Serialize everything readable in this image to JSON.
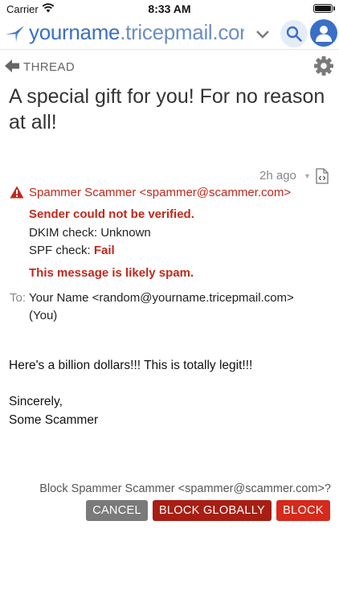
{
  "status_bar": {
    "carrier": "Carrier",
    "time": "8:33 AM",
    "icons": [
      "wifi-icon",
      "battery-icon"
    ]
  },
  "header": {
    "domain_name": "yourname",
    "domain_suffix": ".tricepmail.com",
    "icons": [
      "logo-icon",
      "chevron-down-icon",
      "search-icon",
      "account-icon"
    ],
    "colors": {
      "brand": "#3a6fc8",
      "search_bg": "#e5ecf8"
    }
  },
  "thread": {
    "label": "THREAD",
    "icons": [
      "back-arrow-icon",
      "gear-icon"
    ]
  },
  "message": {
    "subject": "A special gift for you! For no reason at all!",
    "time_ago": "2h ago",
    "time_caret": "▼",
    "from": "Spammer Scammer <spammer@scammer.com>",
    "warnings": {
      "not_verified": "Sender could not be verified.",
      "dkim_label": "DKIM check:",
      "dkim_value": "Unknown",
      "spf_label": "SPF check:",
      "spf_value": "Fail",
      "likely_spam": "This message is likely spam."
    },
    "to_label": "To:",
    "to_value": "Your Name <random@yourname.tricepmail.com>",
    "to_you": "(You)",
    "body": {
      "line1": "Here's a billion dollars!!! This is totally legit!!!",
      "line2": "Sincerely,",
      "line3": "Some Scammer"
    },
    "icons": [
      "warning-icon",
      "view-source-icon"
    ],
    "colors": {
      "warning": "#c0281c"
    }
  },
  "block_bar": {
    "prompt": "Block Spammer Scammer <spammer@scammer.com>?",
    "cancel_label": "CANCEL",
    "block_globally_label": "BLOCK GLOBALLY",
    "block_label": "BLOCK",
    "colors": {
      "cancel": "#7a7a7a",
      "block_globally": "#a81e13",
      "block": "#d52a1c"
    }
  }
}
